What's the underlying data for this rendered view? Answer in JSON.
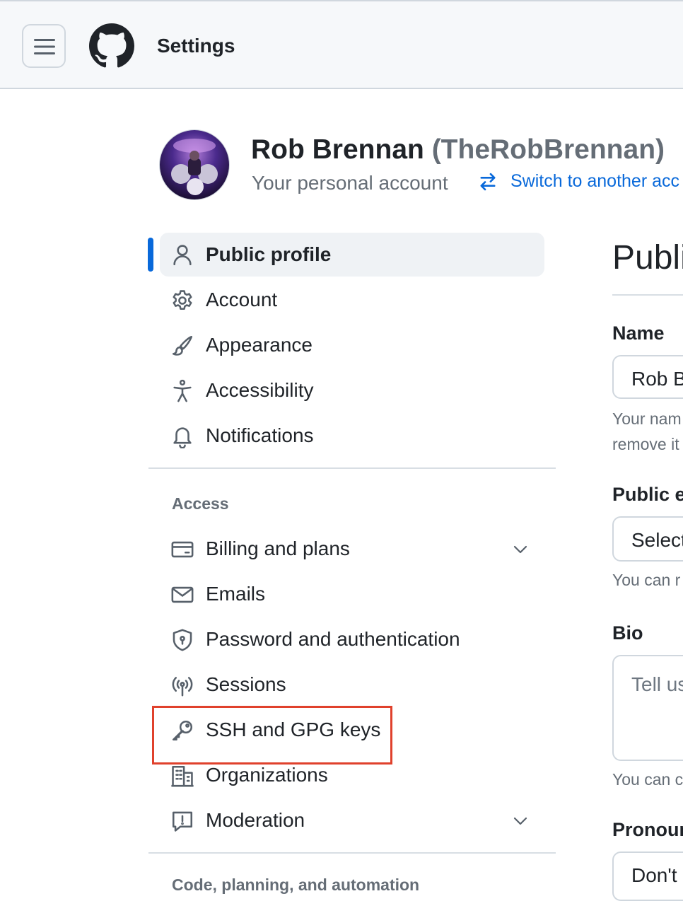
{
  "header": {
    "title": "Settings"
  },
  "account": {
    "name": "Rob Brennan",
    "login": "(TheRobBrennan)",
    "subtitle": "Your personal account",
    "switch_link": "Switch to another acc"
  },
  "nav": {
    "items": [
      {
        "label": "Public profile",
        "icon": "person-icon"
      },
      {
        "label": "Account",
        "icon": "gear-icon"
      },
      {
        "label": "Appearance",
        "icon": "paintbrush-icon"
      },
      {
        "label": "Accessibility",
        "icon": "accessibility-icon"
      },
      {
        "label": "Notifications",
        "icon": "bell-icon"
      }
    ],
    "access_heading": "Access",
    "access_items": [
      {
        "label": "Billing and plans",
        "icon": "credit-card-icon"
      },
      {
        "label": "Emails",
        "icon": "mail-icon"
      },
      {
        "label": "Password and authentication",
        "icon": "shield-lock-icon"
      },
      {
        "label": "Sessions",
        "icon": "broadcast-icon"
      },
      {
        "label": "SSH and GPG keys",
        "icon": "key-icon"
      },
      {
        "label": "Organizations",
        "icon": "organization-icon"
      },
      {
        "label": "Moderation",
        "icon": "report-icon"
      }
    ],
    "next_heading": "Code, planning, and automation"
  },
  "main": {
    "title": "Publi",
    "name_label": "Name",
    "name_value": "Rob B",
    "name_note_1": "Your nam",
    "name_note_2": "remove it",
    "public_email_label": "Public e",
    "public_email_value": "Select",
    "public_email_note": "You can r",
    "bio_label": "Bio",
    "bio_placeholder": "Tell us",
    "bio_note": "You can c",
    "pronouns_label": "Pronour",
    "pronouns_value": "Don't"
  },
  "colors": {
    "accent": "#0969da",
    "highlight": "#e0412c"
  }
}
